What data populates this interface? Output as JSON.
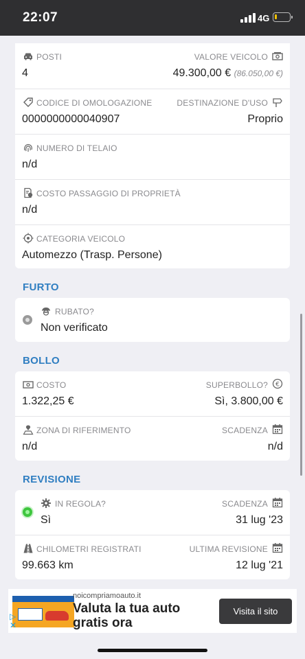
{
  "status_bar": {
    "time": "22:07",
    "network": "4G"
  },
  "vehicle_card": {
    "posti": {
      "label": "POSTI",
      "value": "4"
    },
    "valore_veicolo": {
      "label": "VALORE VEICOLO",
      "value": "49.300,00 €",
      "secondary": "(86.050,00 €)"
    },
    "codice_omologazione": {
      "label": "CODICE DI OMOLOGAZIONE",
      "value": "0000000000040907"
    },
    "destinazione_uso": {
      "label": "DESTINAZIONE D'USO",
      "value": "Proprio"
    },
    "numero_telaio": {
      "label": "NUMERO DI TELAIO",
      "value": "n/d"
    },
    "costo_passaggio": {
      "label": "COSTO PASSAGGIO DI PROPRIETÀ",
      "value": "n/d"
    },
    "categoria_veicolo": {
      "label": "CATEGORIA VEICOLO",
      "value": "Automezzo (Trasp. Persone)"
    }
  },
  "furto": {
    "title": "FURTO",
    "rubato": {
      "label": "RUBATO?",
      "value": "Non verificato"
    }
  },
  "bollo": {
    "title": "BOLLO",
    "costo": {
      "label": "COSTO",
      "value": "1.322,25 €"
    },
    "superbollo": {
      "label": "SUPERBOLLO?",
      "value": "Sì, 3.800,00 €"
    },
    "zona": {
      "label": "ZONA DI RIFERIMENTO",
      "value": "n/d"
    },
    "scadenza": {
      "label": "SCADENZA",
      "value": "n/d"
    }
  },
  "revisione": {
    "title": "REVISIONE",
    "in_regola": {
      "label": "IN REGOLA?",
      "value": "Sì"
    },
    "scadenza": {
      "label": "SCADENZA",
      "value": "31 lug '23"
    },
    "chilometri": {
      "label": "CHILOMETRI REGISTRATI",
      "value": "99.663 km"
    },
    "ultima_revisione": {
      "label": "ULTIMA REVISIONE",
      "value": "12 lug '21"
    }
  },
  "ad": {
    "domain": "noicompriamoauto.it",
    "headline": "Valuta la tua auto gratis ora",
    "cta": "Visita il sito"
  },
  "colors": {
    "section_title": "#2f7ec1",
    "status_bar_bg": "#2f2f31",
    "ok_dot": "#3ec63e",
    "unknown_dot": "#9a9a9a",
    "battery_low": "#f2c200"
  }
}
